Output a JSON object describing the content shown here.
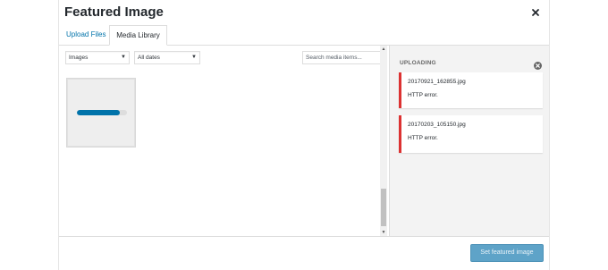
{
  "modal": {
    "title": "Featured Image"
  },
  "tabs": [
    {
      "label": "Upload Files",
      "active": false
    },
    {
      "label": "Media Library",
      "active": true
    }
  ],
  "filters": {
    "type_selected": "Images",
    "date_selected": "All dates",
    "search_placeholder": "Search media items..."
  },
  "attachment": {
    "upload_progress": 0.85
  },
  "sidebar": {
    "title": "UPLOADING",
    "errors": [
      {
        "filename": "20170921_162855.jpg",
        "message": "HTTP error."
      },
      {
        "filename": "20170203_105150.jpg",
        "message": "HTTP error."
      }
    ]
  },
  "toolbar": {
    "primary_label": "Set featured image"
  },
  "icons": {
    "close": "close-icon",
    "dismiss": "dismiss-errors-icon",
    "dropdown": "chevron-down-icon"
  },
  "colors": {
    "accent": "#0073aa",
    "error": "#dc3232",
    "primary_button": "#5ea3c8"
  }
}
